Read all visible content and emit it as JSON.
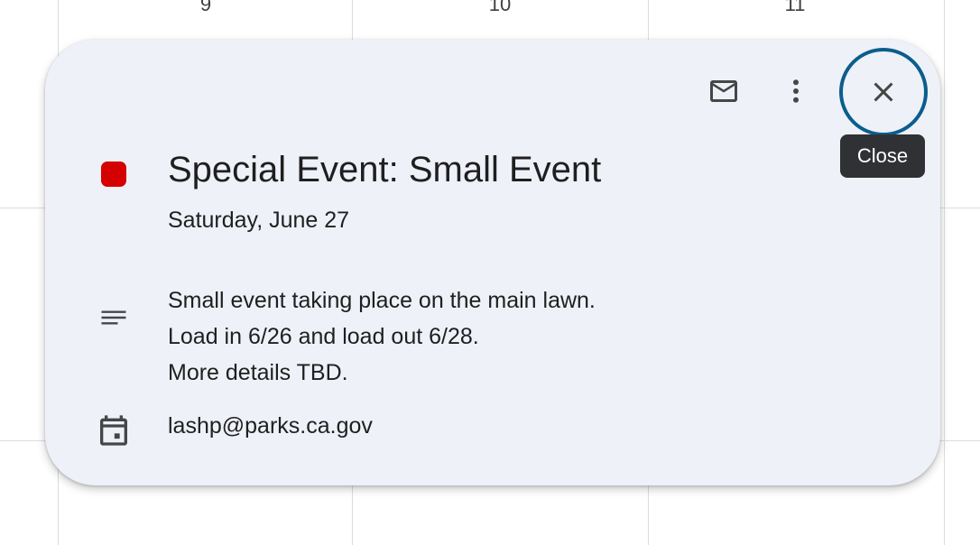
{
  "calendar": {
    "day_numbers": [
      "9",
      "10",
      "11"
    ]
  },
  "event_popup": {
    "title": "Special Event: Small Event",
    "date": "Saturday, June 27",
    "color": "#d50000",
    "description_lines": [
      "Small event taking place on the main lawn.",
      "Load in 6/26 and load out 6/28.",
      "More details TBD."
    ],
    "calendar_name": "lashp@parks.ca.gov",
    "toolbar": {
      "email_icon": "mail-icon",
      "options_icon": "more-vert-icon",
      "close_icon": "close-icon"
    },
    "tooltip": "Close"
  }
}
